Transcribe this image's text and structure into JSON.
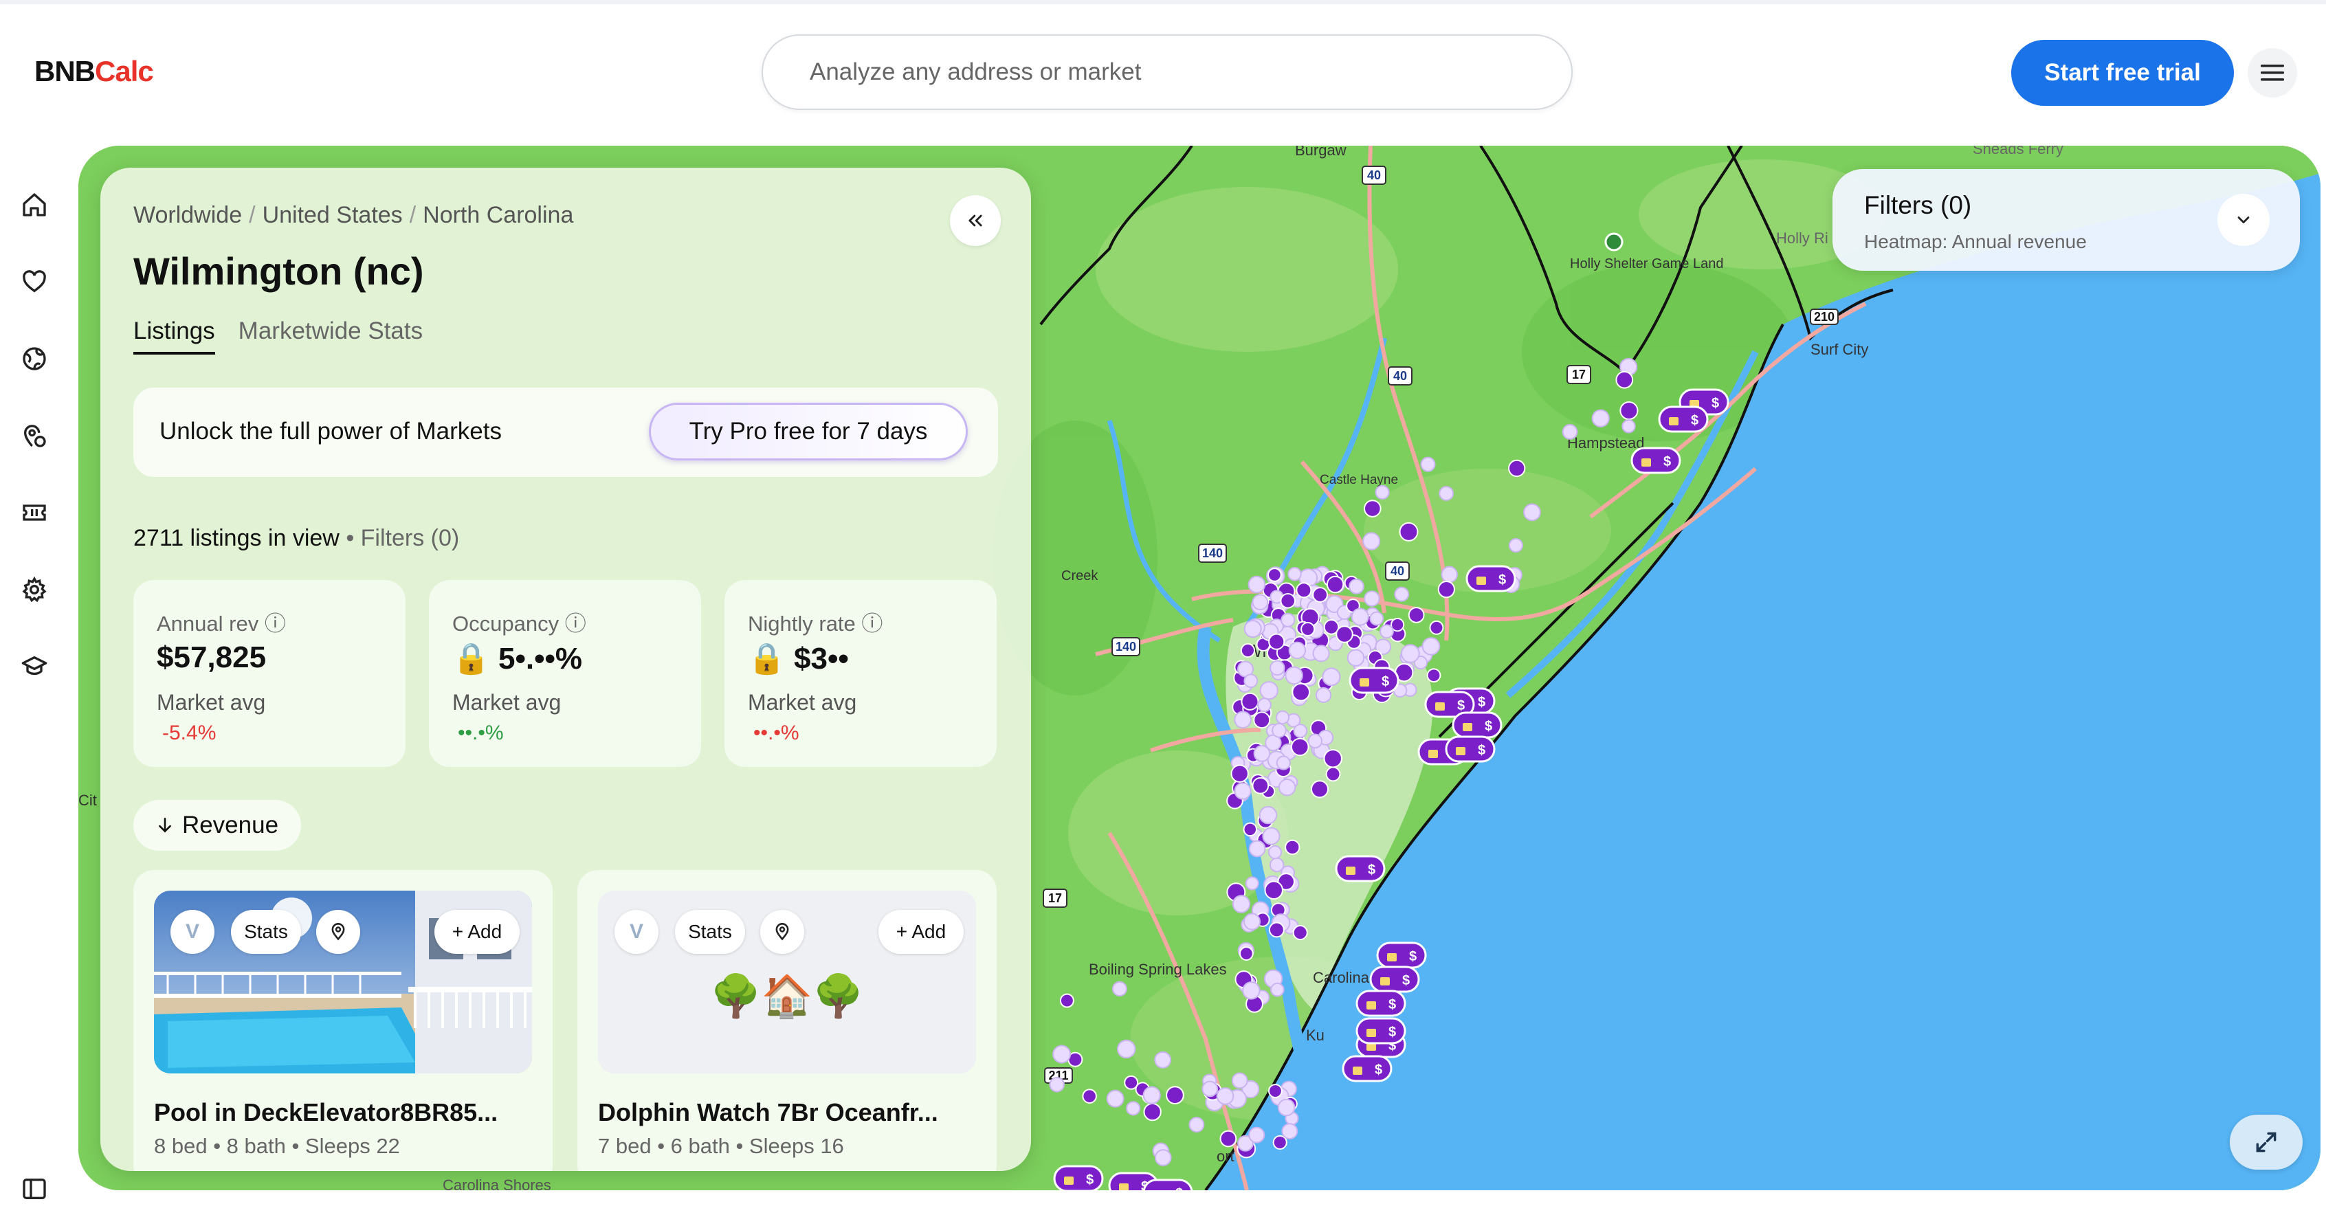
{
  "header": {
    "logo_part1": "BNB",
    "logo_part2": "Calc",
    "search_placeholder": "Analyze any address or market",
    "trial_label": "Start free trial"
  },
  "sidebar": {
    "items": [
      "home-icon",
      "heart-icon",
      "globe-icon",
      "location-icon",
      "ticket-icon",
      "settings-icon",
      "graduation-cap-icon",
      "panel-icon"
    ]
  },
  "panel": {
    "breadcrumbs": [
      "Worldwide",
      "United States",
      "North Carolina"
    ],
    "breadcrumb_sep": "/",
    "title": "Wilmington (nc)",
    "tabs": [
      {
        "label": "Listings",
        "active": true
      },
      {
        "label": "Marketwide Stats",
        "active": false
      }
    ],
    "promo_text": "Unlock the full power of Markets",
    "promo_button": "Try Pro free for 7 days",
    "listings_count": "2711 listings in view",
    "filters_link": "• Filters (0)",
    "stats": [
      {
        "label": "Annual rev",
        "value": "$57,825",
        "market_label": "Market avg",
        "market_pct": "-5.4%",
        "pct_color": "red"
      },
      {
        "label": "Occupancy",
        "value": "🔒 5•.••%",
        "market_label": "Market avg",
        "market_pct": "••.•%",
        "pct_color": "green"
      },
      {
        "label": "Nightly rate",
        "value": "🔒 $3••",
        "market_label": "Market avg",
        "market_pct": "••.•%",
        "pct_color": "red"
      }
    ],
    "sort_label": "Revenue",
    "cards": [
      {
        "stats_label": "Stats",
        "add_label": "+ Add",
        "name": "Pool in DeckElevator8BR85...",
        "meta": "8 bed • 8 bath • Sleeps 22"
      },
      {
        "stats_label": "Stats",
        "add_label": "+ Add",
        "name": "Dolphin Watch 7Br Oceanfr...",
        "meta": "7 bed • 6 bath • Sleeps 16",
        "placeholder_emoji": "🌳🏠🌳"
      }
    ]
  },
  "filters": {
    "title": "Filters (0)",
    "subtitle": "Heatmap: Annual revenue"
  },
  "map": {
    "labels": [
      "Burgaw",
      "Sneads Ferry",
      "Holly Shelter Game Land",
      "Holly Ri",
      "Surf City",
      "Hampstead",
      "Castle Hayne",
      "Wiln",
      "Creek",
      "Boiling Spring Lakes",
      "Carolina Beach",
      "Ku",
      "ch",
      "Cit",
      "Carolina Shores",
      "Southport",
      "ort"
    ],
    "route_shields": [
      "40",
      "40",
      "140",
      "140",
      "17",
      "17",
      "210",
      "211",
      "40"
    ],
    "colors": {
      "land": "#7ccf5c",
      "ocean": "#56b4f5",
      "marker": "#7b1fc9",
      "marker_light": "#e9dbff"
    }
  }
}
